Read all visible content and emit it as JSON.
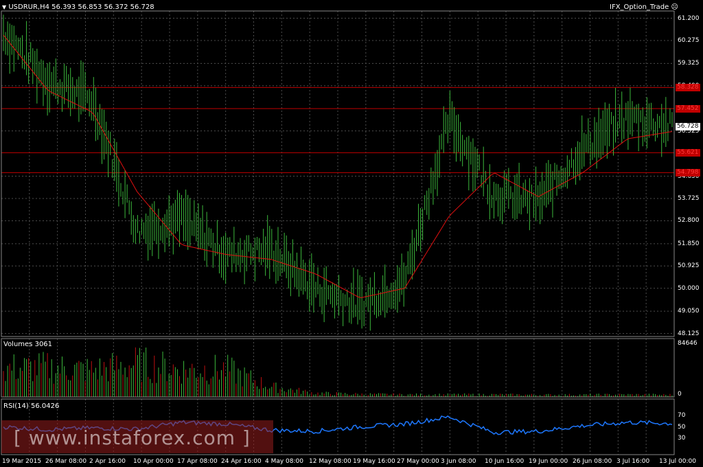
{
  "header": {
    "symbol_line": "USDRUR,H4  56.393 56.853 56.372 56.728",
    "expert_name": "IFX_Option_Trade",
    "expert_icon": "smiley-icon"
  },
  "price_axis": {
    "ticks": [
      "61.200",
      "60.275",
      "59.325",
      "58.400",
      "56.525",
      "54.650",
      "53.725",
      "52.800",
      "51.850",
      "50.925",
      "50.000",
      "49.050",
      "48.125"
    ],
    "levels": [
      "58.328",
      "57.452",
      "55.621",
      "54.798"
    ],
    "current": "56.728"
  },
  "volumes": {
    "label": "Volumes 3061",
    "ticks": [
      "84646",
      "0"
    ]
  },
  "rsi": {
    "label": "RSI(14) 56.0426",
    "ticks": [
      "70",
      "50",
      "30"
    ]
  },
  "time_axis": {
    "labels": [
      "19 Mar 2015",
      "26 Mar 08:00",
      "2 Apr 16:00",
      "10 Apr 00:00",
      "17 Apr 08:00",
      "24 Apr 16:00",
      "4 May 08:00",
      "12 May 08:00",
      "19 May 16:00",
      "27 May 00:00",
      "3 Jun 08:00",
      "10 Jun 16:00",
      "19 Jun 00:00",
      "26 Jun 08:00",
      "3 Jul 16:00",
      "13 Jul 00:00"
    ]
  },
  "watermark": {
    "text": "[ www.instaforex.com ]"
  },
  "chart_data": {
    "type": "line",
    "title": "USDRUR,H4",
    "ylim": [
      48.0,
      61.5
    ],
    "x": [
      "19 Mar 2015",
      "26 Mar 08:00",
      "2 Apr 16:00",
      "10 Apr 00:00",
      "17 Apr 08:00",
      "24 Apr 16:00",
      "4 May 08:00",
      "12 May 08:00",
      "19 May 16:00",
      "27 May 00:00",
      "3 Jun 08:00",
      "10 Jun 16:00",
      "19 Jun 00:00",
      "26 Jun 08:00",
      "3 Jul 16:00",
      "13 Jul 00:00"
    ],
    "series": [
      {
        "name": "",
        "values": [
          60.6,
          58.6,
          57.8,
          52.4,
          52.9,
          51.4,
          51.6,
          50.0,
          49.3,
          50.3,
          57.0,
          53.9,
          53.6,
          55.8,
          57.1,
          56.7
        ]
      },
      {
        "name": "",
        "values": [
          60.5,
          58.2,
          57.3,
          54.0,
          51.8,
          51.4,
          51.2,
          50.6,
          49.6,
          50.0,
          53.0,
          54.8,
          53.8,
          54.8,
          56.2,
          56.5
        ]
      }
    ],
    "horizontal_levels": [
      58.328,
      57.452,
      55.621,
      54.798
    ],
    "volume": {
      "ylim": [
        0,
        84646
      ],
      "values": [
        62000,
        64000,
        58000,
        72000,
        60000,
        60000,
        22000,
        8000,
        6000,
        5000,
        5000,
        5000,
        4500,
        4500,
        5000,
        4500
      ]
    },
    "rsi": {
      "ylim": [
        0,
        100
      ],
      "values": [
        50,
        45,
        48,
        46,
        58,
        55,
        44,
        42,
        50,
        55,
        68,
        40,
        42,
        52,
        58,
        56
      ]
    },
    "colors": {
      "candle": "#3cb93c",
      "ma": "#e01010",
      "level": "#c00000",
      "rsi": "#1e78ff",
      "volume": "#3cb93c",
      "volume_down": "#c01010",
      "grid": "#4d4d4d"
    }
  }
}
